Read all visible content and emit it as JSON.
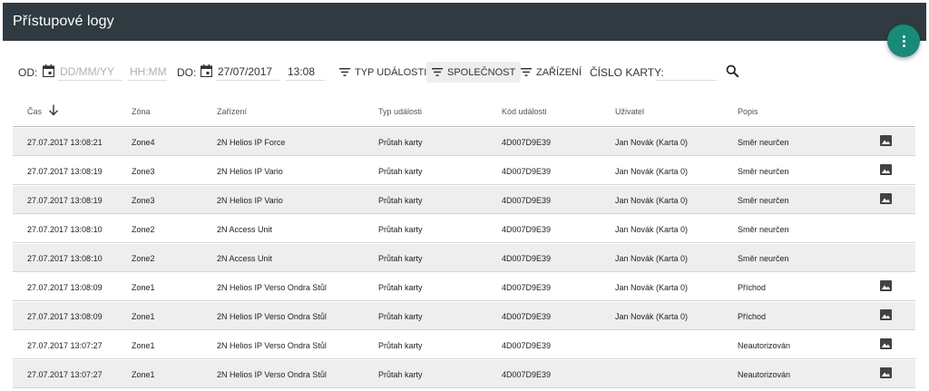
{
  "header": {
    "title": "Přístupové logy"
  },
  "filters": {
    "from_label": "OD:",
    "from_date_placeholder": "DD/MM/YY",
    "from_time_placeholder": "HH:MM",
    "to_label": "DO:",
    "to_date_value": "27/07/2017",
    "to_time_value": "13:08",
    "event_type_label": "TYP UDÁLOSTI",
    "company_label": "SPOLEČNOST",
    "device_label": "ZAŘÍZENÍ",
    "card_number_label": "ČÍSLO KARTY:",
    "card_number_value": ""
  },
  "table": {
    "columns": [
      "Čas",
      "Zóna",
      "Zařízení",
      "Typ události",
      "Kód události",
      "Uživatel",
      "Popis"
    ],
    "sort": {
      "column": "Čas",
      "direction": "descending"
    },
    "rows": [
      {
        "time": "27.07.2017 13:08:21",
        "zone": "Zone4",
        "device": "2N Helios IP Force",
        "event_type": "Průtah karty",
        "event_code": "4D007D9E39",
        "user": "Jan Novák (Karta 0)",
        "description": "Směr neurčen",
        "has_image": true
      },
      {
        "time": "27.07.2017 13:08:19",
        "zone": "Zone3",
        "device": "2N Helios IP Vario",
        "event_type": "Průtah karty",
        "event_code": "4D007D9E39",
        "user": "Jan Novák (Karta 0)",
        "description": "Směr neurčen",
        "has_image": true
      },
      {
        "time": "27.07.2017 13:08:19",
        "zone": "Zone3",
        "device": "2N Helios IP Vario",
        "event_type": "Průtah karty",
        "event_code": "4D007D9E39",
        "user": "Jan Novák (Karta 0)",
        "description": "Směr neurčen",
        "has_image": true
      },
      {
        "time": "27.07.2017 13:08:10",
        "zone": "Zone2",
        "device": "2N Access Unit",
        "event_type": "Průtah karty",
        "event_code": "4D007D9E39",
        "user": "Jan Novák (Karta 0)",
        "description": "Směr neurčen",
        "has_image": false
      },
      {
        "time": "27.07.2017 13:08:10",
        "zone": "Zone2",
        "device": "2N Access Unit",
        "event_type": "Průtah karty",
        "event_code": "4D007D9E39",
        "user": "Jan Novák (Karta 0)",
        "description": "Směr neurčen",
        "has_image": false
      },
      {
        "time": "27.07.2017 13:08:09",
        "zone": "Zone1",
        "device": "2N Helios IP Verso Ondra Stůl",
        "event_type": "Průtah karty",
        "event_code": "4D007D9E39",
        "user": "Jan Novák (Karta 0)",
        "description": "Příchod",
        "has_image": true
      },
      {
        "time": "27.07.2017 13:08:09",
        "zone": "Zone1",
        "device": "2N Helios IP Verso Ondra Stůl",
        "event_type": "Průtah karty",
        "event_code": "4D007D9E39",
        "user": "Jan Novák (Karta 0)",
        "description": "Příchod",
        "has_image": true
      },
      {
        "time": "27.07.2017 13:07:27",
        "zone": "Zone1",
        "device": "2N Helios IP Verso Ondra Stůl",
        "event_type": "Průtah karty",
        "event_code": "4D007D9E39",
        "user": "",
        "description": "Neautorizován",
        "has_image": true
      },
      {
        "time": "27.07.2017 13:07:27",
        "zone": "Zone1",
        "device": "2N Helios IP Verso Ondra Stůl",
        "event_type": "Průtah karty",
        "event_code": "4D007D9E39",
        "user": "",
        "description": "Neautorizován",
        "has_image": true
      }
    ]
  },
  "colors": {
    "appbar": "#2f3b41",
    "fab": "#1a8a78",
    "row_shaded": "#eeeeee"
  },
  "icons": {
    "fab": "more-vert-icon",
    "date": "calendar-icon",
    "filter": "filter-list-icon",
    "search": "search-icon",
    "sort": "arrow-down-icon",
    "row_image": "image-icon"
  }
}
